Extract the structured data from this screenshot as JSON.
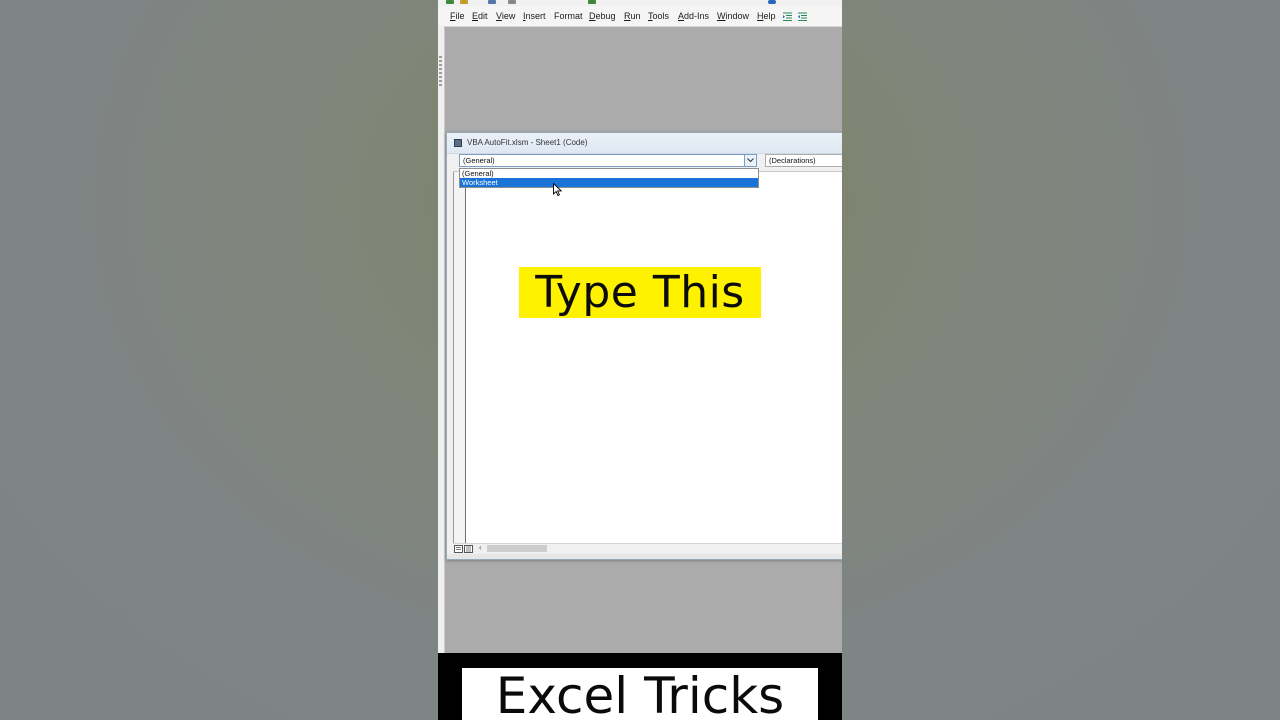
{
  "menu": {
    "items": [
      {
        "label": "File",
        "ul": "F",
        "rest": "ile"
      },
      {
        "label": "Edit",
        "ul": "E",
        "rest": "dit"
      },
      {
        "label": "View",
        "ul": "V",
        "rest": "iew"
      },
      {
        "label": "Insert",
        "ul": "I",
        "rest": "nsert"
      },
      {
        "label": "Format",
        "ul": "",
        "rest": "Format"
      },
      {
        "label": "Debug",
        "ul": "D",
        "rest": "ebug"
      },
      {
        "label": "Run",
        "ul": "R",
        "rest": "un"
      },
      {
        "label": "Tools",
        "ul": "T",
        "rest": "ools"
      },
      {
        "label": "Add-Ins",
        "ul": "A",
        "rest": "dd-Ins"
      },
      {
        "label": "Window",
        "ul": "W",
        "rest": "indow"
      },
      {
        "label": "Help",
        "ul": "H",
        "rest": "elp"
      }
    ]
  },
  "code_window": {
    "title": "VBA AutoFit.xlsm - Sheet1 (Code)",
    "object_combo": {
      "value": "(General)",
      "options": [
        "(General)",
        "Worksheet"
      ],
      "highlighted": "Worksheet"
    },
    "procedure_combo": {
      "value": "(Declarations)"
    }
  },
  "captions": {
    "instruction": "Type This",
    "channel": "Excel Tricks"
  },
  "colors": {
    "highlight": "#fff200",
    "selection": "#1a73d6"
  }
}
